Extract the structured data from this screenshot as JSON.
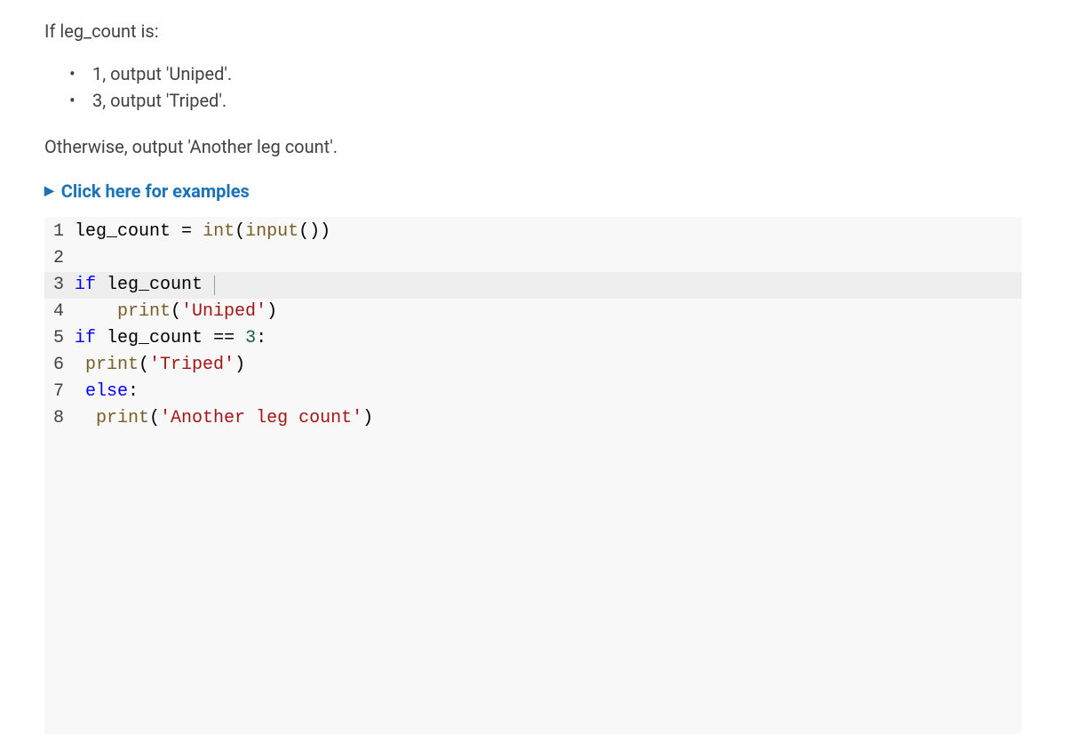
{
  "intro": "If leg_count is:",
  "bullets": [
    "1, output 'Uniped'.",
    "3, output 'Triped'."
  ],
  "otherwise": "Otherwise, output 'Another leg count'.",
  "examples_label": "Click here for examples",
  "code": {
    "lines": [
      {
        "num": "1",
        "highlighted": false,
        "tokens": [
          {
            "t": "ident",
            "v": "leg_count"
          },
          {
            "t": "plain",
            "v": " "
          },
          {
            "t": "op",
            "v": "="
          },
          {
            "t": "plain",
            "v": " "
          },
          {
            "t": "fn",
            "v": "int"
          },
          {
            "t": "plain",
            "v": "("
          },
          {
            "t": "fn",
            "v": "input"
          },
          {
            "t": "plain",
            "v": "())"
          }
        ]
      },
      {
        "num": "2",
        "highlighted": false,
        "tokens": []
      },
      {
        "num": "3",
        "highlighted": true,
        "tokens": [
          {
            "t": "kw",
            "v": "if"
          },
          {
            "t": "plain",
            "v": " "
          },
          {
            "t": "ident",
            "v": "leg_count"
          },
          {
            "t": "plain",
            "v": " "
          },
          {
            "t": "cursor",
            "v": ""
          }
        ]
      },
      {
        "num": "4",
        "highlighted": false,
        "tokens": [
          {
            "t": "plain",
            "v": "    "
          },
          {
            "t": "fn",
            "v": "print"
          },
          {
            "t": "plain",
            "v": "("
          },
          {
            "t": "str",
            "v": "'Uniped'"
          },
          {
            "t": "plain",
            "v": ")"
          }
        ]
      },
      {
        "num": "5",
        "highlighted": false,
        "tokens": [
          {
            "t": "kw",
            "v": "if"
          },
          {
            "t": "plain",
            "v": " "
          },
          {
            "t": "ident",
            "v": "leg_count"
          },
          {
            "t": "plain",
            "v": " "
          },
          {
            "t": "op",
            "v": "=="
          },
          {
            "t": "plain",
            "v": " "
          },
          {
            "t": "num",
            "v": "3"
          },
          {
            "t": "plain",
            "v": ":"
          }
        ]
      },
      {
        "num": "6",
        "highlighted": false,
        "tokens": [
          {
            "t": "plain",
            "v": " "
          },
          {
            "t": "fn",
            "v": "print"
          },
          {
            "t": "plain",
            "v": "("
          },
          {
            "t": "str",
            "v": "'Triped'"
          },
          {
            "t": "plain",
            "v": ")"
          }
        ]
      },
      {
        "num": "7",
        "highlighted": false,
        "tokens": [
          {
            "t": "plain",
            "v": " "
          },
          {
            "t": "kw",
            "v": "else"
          },
          {
            "t": "plain",
            "v": ":"
          }
        ]
      },
      {
        "num": "8",
        "highlighted": false,
        "tokens": [
          {
            "t": "plain",
            "v": "  "
          },
          {
            "t": "fn",
            "v": "print"
          },
          {
            "t": "plain",
            "v": "("
          },
          {
            "t": "str",
            "v": "'Another leg count'"
          },
          {
            "t": "plain",
            "v": ")"
          }
        ]
      }
    ]
  }
}
